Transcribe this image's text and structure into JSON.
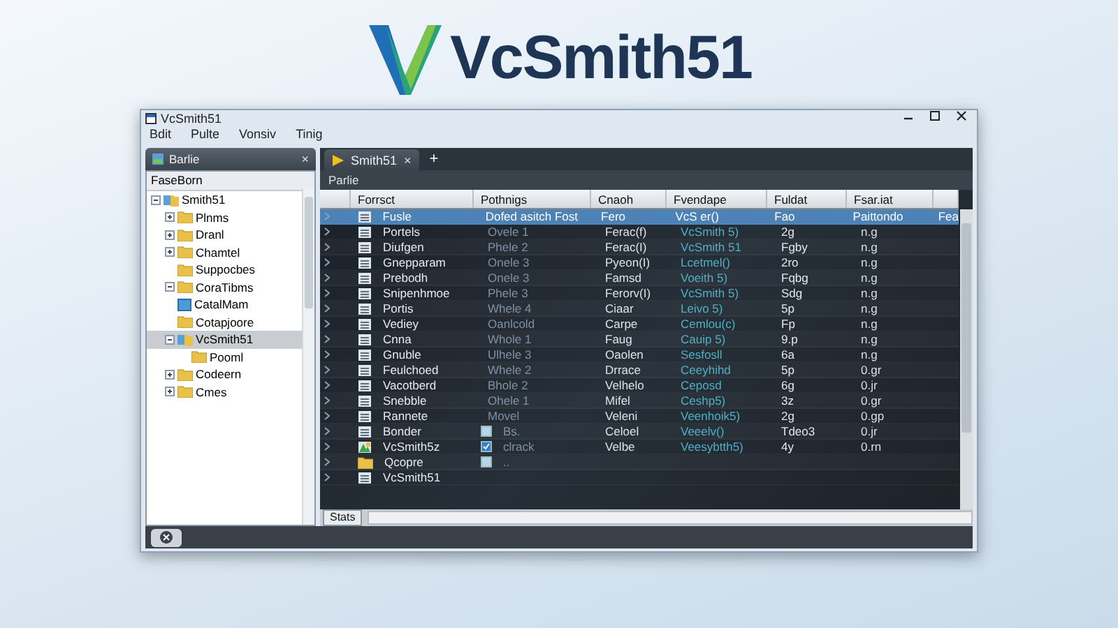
{
  "logo": {
    "text": "VcSmith51"
  },
  "window": {
    "title": "VcSmith51",
    "menu": [
      "Bdit",
      "Pulte",
      "Vonsiv",
      "Tinig"
    ]
  },
  "sidebar": {
    "tab": "Barlie",
    "close": "×",
    "header": "FaseBorn",
    "tree": [
      {
        "label": "Smith51",
        "kind": "drive",
        "expanded": true,
        "children": [
          {
            "label": "Plnms",
            "kind": "folder",
            "expanded": false
          },
          {
            "label": "Dranl",
            "kind": "folder",
            "expanded": false
          },
          {
            "label": "Chamtel",
            "kind": "folder",
            "expanded": false
          },
          {
            "label": "Suppocbes",
            "kind": "folder"
          },
          {
            "label": "CoraTibms",
            "kind": "folder",
            "expanded": true
          },
          {
            "label": "CatalMam",
            "kind": "file"
          },
          {
            "label": "Cotapjoore",
            "kind": "folder"
          },
          {
            "label": "VcSmith51",
            "kind": "drive",
            "expanded": true,
            "selected": true,
            "children": [
              {
                "label": "Pooml",
                "kind": "folder"
              }
            ]
          },
          {
            "label": "Codeern",
            "kind": "folder",
            "expanded": false
          },
          {
            "label": "Cmes",
            "kind": "folder",
            "expanded": false
          }
        ]
      }
    ]
  },
  "main": {
    "tab": "Smith51",
    "tab_close": "×",
    "new_tab": "+",
    "breadcrumb": "Parlie",
    "table": {
      "columns": [
        "Forrsct",
        "Pothnigs",
        "Cnaoh",
        "Fvendape",
        "Fuldat",
        "Fsar.iat"
      ],
      "rows": [
        {
          "kind": "doc",
          "selected": true,
          "cells": [
            "Fusle",
            "Dofed asitch Fost",
            "Fero",
            "VcS er()",
            "Fao",
            "Paittondo",
            "Fea"
          ]
        },
        {
          "kind": "doc",
          "selected": false,
          "cells": [
            "Portels",
            "Ovele 1",
            "Ferac(f)",
            "VcSmith 5)",
            "2g",
            "n.g"
          ]
        },
        {
          "kind": "doc",
          "selected": false,
          "cells": [
            "Diufgen",
            "Phele 2",
            "Ferac(I)",
            "VcSmith 51",
            "Fgby",
            "n.g"
          ]
        },
        {
          "kind": "doc",
          "selected": false,
          "cells": [
            "Gnepparam",
            "Onele 3",
            "Pyeon(I)",
            "Lcetmel()",
            "2ro",
            "n.g"
          ]
        },
        {
          "kind": "doc",
          "selected": false,
          "cells": [
            "Prebodh",
            "Onele 3",
            "Famsd",
            "Voeith 5)",
            "Fqbg",
            "n.g"
          ]
        },
        {
          "kind": "doc",
          "selected": false,
          "cells": [
            "Snipenhmoe",
            "Phele 3",
            "Ferorv(I)",
            "VcSmith 5)",
            "Sdg",
            "n.g"
          ]
        },
        {
          "kind": "doc",
          "selected": false,
          "cells": [
            "Portis",
            "Whele 4",
            "Ciaar",
            "Leivo 5)",
            "5p",
            "n.g"
          ]
        },
        {
          "kind": "doc",
          "selected": false,
          "cells": [
            "Vediey",
            "Oanlcold",
            "Carpe",
            "Cemlou(c)",
            "Fp",
            "n.g"
          ]
        },
        {
          "kind": "doc",
          "selected": false,
          "cells": [
            "Cnna",
            "Whole 1",
            "Faug",
            "Cauip 5)",
            "9.p",
            "n.g"
          ]
        },
        {
          "kind": "doc",
          "selected": false,
          "cells": [
            "Gnuble",
            "Ulhele 3",
            "Oaolen",
            "Sesfosll",
            "6a",
            "n.g"
          ]
        },
        {
          "kind": "doc",
          "selected": false,
          "cells": [
            "Feulchoed",
            "Whele 2",
            "Drrace",
            "Ceeyhihd",
            "5p",
            "0.gr"
          ]
        },
        {
          "kind": "doc",
          "selected": false,
          "cells": [
            "Vacotberd",
            "Bhole 2",
            "Velhelo",
            "Ceposd",
            "6g",
            "0.jr"
          ]
        },
        {
          "kind": "doc",
          "selected": false,
          "cells": [
            "Snebble",
            "Ohele 1",
            "Mifel",
            "Ceshp5)",
            "3z",
            "0.gr"
          ]
        },
        {
          "kind": "doc",
          "selected": false,
          "cells": [
            "Rannete",
            "Movel",
            "Veleni",
            "Veenhoik5)",
            "2g",
            "0.gp"
          ]
        },
        {
          "kind": "doc",
          "selected": false,
          "checked": false,
          "cells": [
            "Bonder",
            "Bs.",
            "Celoel",
            "Veeelv()",
            "Tdeo3",
            "0.jr"
          ]
        },
        {
          "kind": "app",
          "selected": false,
          "checked": true,
          "cells": [
            "VcSmith5z",
            "clrack",
            "Velbe",
            "Veesybtth5)",
            "4y",
            "0.rn"
          ]
        },
        {
          "kind": "folder",
          "selected": false,
          "checked": false,
          "cells": [
            "Qcopre",
            ".."
          ]
        },
        {
          "kind": "doc",
          "selected": false,
          "cells": [
            "VcSmith51"
          ]
        }
      ]
    },
    "bottom_tab": "Stats"
  }
}
